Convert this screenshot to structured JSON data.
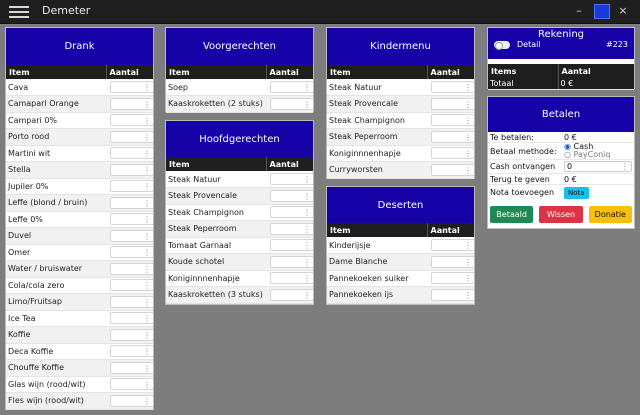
{
  "app": {
    "title": "Demeter",
    "menu_icon": "hamburger-icon",
    "minimize": "–",
    "maximize": "□",
    "close": "×"
  },
  "columns": {
    "item": "Item",
    "amount": "Aantal"
  },
  "drank": {
    "title": "Drank",
    "items": [
      "Cava",
      "Camapari Orange",
      "Campari 0%",
      "Porto rood",
      "Martini wit",
      "Stella",
      "Jupiler 0%",
      "Leffe (blond / bruin)",
      "Leffe 0%",
      "Duvel",
      "Omer",
      "Water / bruiswater",
      "Cola/cola zero",
      "Limo/Fruitsap",
      "Ice Tea",
      "Koffie",
      "Deca Koffie",
      "Chouffe Koffie",
      "Glas wijn (rood/wit)",
      "Fles wijn (rood/wit)"
    ]
  },
  "voorgerechten": {
    "title": "Voorgerechten",
    "items": [
      "Soep",
      "Kaaskroketten (2 stuks)"
    ]
  },
  "hoofdgerechten": {
    "title": "Hoofdgerechten",
    "items": [
      "Steak Natuur",
      "Steak Provencale",
      "Steak Champignon",
      "Steak Peperroom",
      "Tomaat Garnaal",
      "Koude schotel",
      "Koniginnnenhapje",
      "Kaaskroketten (3 stuks)"
    ]
  },
  "kindermenu": {
    "title": "Kindermenu",
    "items": [
      "Steak Natuur",
      "Steak Provencale",
      "Steak Champignon",
      "Steak Peperroom",
      "Koniginnnenhapje",
      "Curryworsten"
    ]
  },
  "deserten": {
    "title": "Deserten",
    "items": [
      "Kinderijsje",
      "Dame Blanche",
      "Pannekoeken suiker",
      "Pannekoeken ijs"
    ]
  },
  "rekening": {
    "title": "Rekening",
    "detail_label": "Detail",
    "number": "#223",
    "col_items": "Items",
    "col_amount": "Aantal",
    "total_label": "Totaal",
    "total_value": "0 €"
  },
  "betalen": {
    "title": "Betalen",
    "to_pay_label": "Te betalen:",
    "to_pay_value": "0 €",
    "method_label": "Betaal methode:",
    "method_cash": "Cash",
    "method_payconiq": "PayConiq",
    "received_label": "Cash ontvangen",
    "received_value": "0",
    "change_label": "Terug te geven",
    "change_value": "0 €",
    "note_label": "Nota toevoegen",
    "note_button": "Nota",
    "btn_paid": "Betaald",
    "btn_clear": "Wissen",
    "btn_donation": "Donatie",
    "colors": {
      "paid": "#1e8a55",
      "clear": "#dc3444",
      "donation": "#fbbf0a",
      "note": "#14c0ef"
    }
  }
}
